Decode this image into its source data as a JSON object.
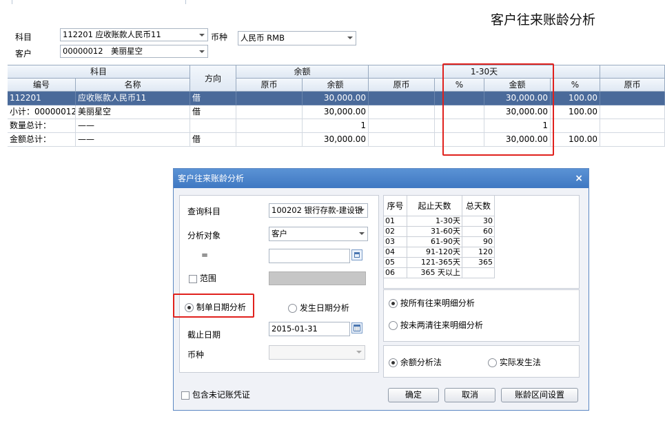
{
  "report_title": "客户往来账龄分析",
  "filters": {
    "subject_label": "科目",
    "subject_value": "112201 应收账款人民币11",
    "currency_label": "币种",
    "currency_value": "人民币 RMB",
    "customer_label": "客户",
    "customer_value": "00000012　美丽星空"
  },
  "grid": {
    "h_subject": "科目",
    "h_code": "编号",
    "h_name": "名称",
    "h_direction": "方向",
    "h_balance": "余额",
    "h_orig1": "原币",
    "h_amount1": "余额",
    "h_bucket": "1-30天",
    "h_orig2": "原币",
    "h_pct1": "%",
    "h_amount2": "金额",
    "h_pct2": "%",
    "h_orig3": "原币",
    "rows": [
      {
        "code": "112201",
        "name": "应收账款人民币11",
        "dir": "借",
        "bal": "30,000.00",
        "amt": "30,000.00",
        "pct": "100.00"
      },
      {
        "code": "小计：00000012",
        "name": "美丽星空",
        "dir": "借",
        "bal": "30,000.00",
        "amt": "30,000.00",
        "pct": "100.00"
      },
      {
        "code": "数量总计：",
        "name": "——",
        "dir": "",
        "bal": "1",
        "amt": "1",
        "pct": ""
      },
      {
        "code": "金额总计：",
        "name": "——",
        "dir": "借",
        "bal": "30,000.00",
        "amt": "30,000.00",
        "pct": "100.00"
      }
    ]
  },
  "dialog": {
    "title": "客户往来账龄分析",
    "close": "×",
    "query_subject_label": "查询科目",
    "query_subject_value": "100202 银行存款-建设银",
    "analysis_target_label": "分析对象",
    "analysis_target_value": "客户",
    "equals": "=",
    "range_label": "范围",
    "radio_doc_date": "制单日期分析",
    "radio_occur_date": "发生日期分析",
    "cutoff_label": "截止日期",
    "cutoff_value": "2015-01-31",
    "currency_label": "币种",
    "include_unposted": "包含未记账凭证",
    "interval_headers": [
      "序号",
      "起止天数",
      "总天数"
    ],
    "intervals": [
      [
        "01",
        "1-30天",
        "30"
      ],
      [
        "02",
        "31-60天",
        "60"
      ],
      [
        "03",
        "61-90天",
        "90"
      ],
      [
        "04",
        "91-120天",
        "120"
      ],
      [
        "05",
        "121-365天",
        "365"
      ],
      [
        "06",
        "365 天以上",
        ""
      ]
    ],
    "radio_all_detail": "按所有往来明细分析",
    "radio_unsettled": "按未两清往来明细分析",
    "radio_balance": "余额分析法",
    "radio_actual": "实际发生法",
    "ok": "确定",
    "cancel": "取消",
    "interval_setup": "账龄区间设置"
  }
}
